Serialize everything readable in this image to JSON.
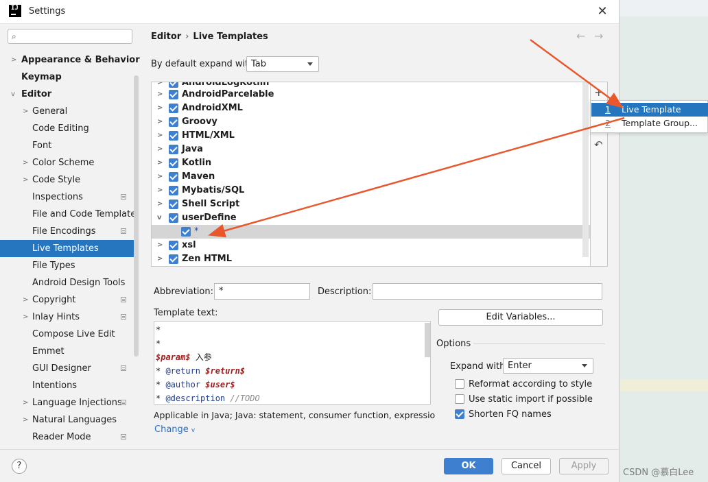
{
  "window": {
    "title": "Settings"
  },
  "sidebar": {
    "search_placeholder": "",
    "items": [
      {
        "label": "Appearance & Behavior"
      },
      {
        "label": "Keymap"
      },
      {
        "label": "Editor"
      },
      {
        "label": "General"
      },
      {
        "label": "Code Editing"
      },
      {
        "label": "Font"
      },
      {
        "label": "Color Scheme"
      },
      {
        "label": "Code Style"
      },
      {
        "label": "Inspections"
      },
      {
        "label": "File and Code Template"
      },
      {
        "label": "File Encodings"
      },
      {
        "label": "Live Templates"
      },
      {
        "label": "File Types"
      },
      {
        "label": "Android Design Tools"
      },
      {
        "label": "Copyright"
      },
      {
        "label": "Inlay Hints"
      },
      {
        "label": "Compose Live Edit"
      },
      {
        "label": "Emmet"
      },
      {
        "label": "GUI Designer"
      },
      {
        "label": "Intentions"
      },
      {
        "label": "Language Injections"
      },
      {
        "label": "Natural Languages"
      },
      {
        "label": "Reader Mode"
      }
    ]
  },
  "breadcrumb": {
    "parent": "Editor",
    "current": "Live Templates"
  },
  "expand": {
    "label": "By default expand with",
    "value": "Tab"
  },
  "groups": [
    {
      "name": "AndroidLogKotlin"
    },
    {
      "name": "AndroidParcelable"
    },
    {
      "name": "AndroidXML"
    },
    {
      "name": "Groovy"
    },
    {
      "name": "HTML/XML"
    },
    {
      "name": "Java"
    },
    {
      "name": "Kotlin"
    },
    {
      "name": "Maven"
    },
    {
      "name": "Mybatis/SQL"
    },
    {
      "name": "Shell Script"
    },
    {
      "name": "userDefine"
    },
    {
      "name": "*"
    },
    {
      "name": "xsl"
    },
    {
      "name": "Zen HTML"
    }
  ],
  "popup": {
    "items": [
      {
        "num": "1",
        "label": "Live Template"
      },
      {
        "num": "2",
        "label": "Template Group..."
      }
    ]
  },
  "form": {
    "abbreviation_label": "Abbreviation:",
    "abbreviation_value": "*",
    "description_label": "Description:",
    "description_value": "",
    "template_text_label": "Template text:",
    "edit_variables": "Edit Variables...",
    "applicable": "Applicable in Java; Java: statement, consumer function, expression, '...",
    "change": "Change"
  },
  "template_lines": {
    "l1": "*",
    "l2": " *",
    "l3_var": "$param$",
    "l3_text": " 入参",
    "l4_star": " * ",
    "l4_kw": "@return",
    "l4_var": " $return$",
    "l5_star": " * ",
    "l5_kw": "@author",
    "l5_var": " $user$",
    "l6_star": " * ",
    "l6_kw": "@description",
    "l6_cmt": " //TODO"
  },
  "options": {
    "title": "Options",
    "expand_with_label": "Expand with",
    "expand_with_value": "Enter",
    "reformat": "Reformat according to style",
    "static_import": "Use static import if possible",
    "shorten_fq": "Shorten FQ names"
  },
  "buttons": {
    "ok": "OK",
    "cancel": "Cancel",
    "apply": "Apply"
  },
  "watermark": "CSDN @慕白Lee",
  "colors": {
    "accent": "#2675bf",
    "annotation_arrow": "#e8582c"
  }
}
